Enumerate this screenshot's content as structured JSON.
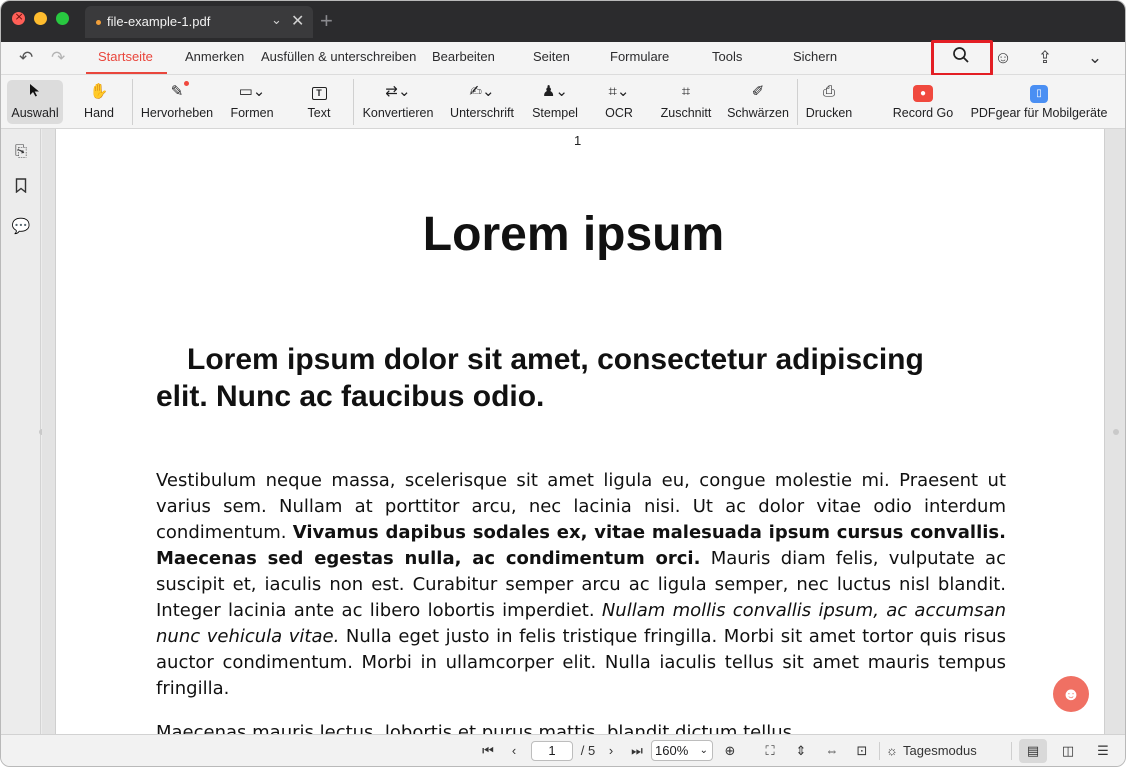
{
  "window": {
    "tab_title": "file-example-1.pdf"
  },
  "menu": {
    "tabs": [
      "Startseite",
      "Anmerken",
      "Ausfüllen & unterschreiben",
      "Bearbeiten",
      "Seiten",
      "Formulare",
      "Tools",
      "Sichern"
    ],
    "active_tab": "Startseite"
  },
  "toolbar": {
    "tools": [
      {
        "label": "Auswahl",
        "icon": "cursor-arrow-icon",
        "glyph": "➤"
      },
      {
        "label": "Hand",
        "icon": "hand-icon",
        "glyph": "✋"
      },
      {
        "label": "Hervorheben",
        "icon": "highlighter-icon",
        "glyph": "✎"
      },
      {
        "label": "Formen",
        "icon": "rectangle-shape-icon",
        "glyph": "▭⌄"
      },
      {
        "label": "Text",
        "icon": "text-box-icon",
        "glyph": "T"
      },
      {
        "label": "Konvertieren",
        "icon": "convert-icon",
        "glyph": "⇄⌄"
      },
      {
        "label": "Unterschrift",
        "icon": "signature-icon",
        "glyph": "✍⌄"
      },
      {
        "label": "Stempel",
        "icon": "stamp-icon",
        "glyph": "♟⌄"
      },
      {
        "label": "OCR",
        "icon": "ocr-icon",
        "glyph": "⌗⌄"
      },
      {
        "label": "Zuschnitt",
        "icon": "crop-icon",
        "glyph": "⌗"
      },
      {
        "label": "Schwärzen",
        "icon": "redact-icon",
        "glyph": "✐"
      },
      {
        "label": "Drucken",
        "icon": "printer-icon",
        "glyph": "⎙"
      },
      {
        "label": "Record Go",
        "icon": "record-icon",
        "glyph": "●"
      },
      {
        "label": "PDFgear für Mobilgeräte",
        "icon": "mobile-device-icon",
        "glyph": "▯"
      }
    ]
  },
  "document": {
    "page_label": "1",
    "title": "Lorem ipsum",
    "subtitle": "Lorem ipsum dolor sit amet, consectetur adipiscing elit. Nunc ac faucibus odio.",
    "para1_a": "Vestibulum neque massa, scelerisque sit amet ligula eu, congue molestie mi. Praesent ut varius sem. Nullam at porttitor arcu, nec lacinia nisi. Ut ac dolor vitae odio interdum condimentum. ",
    "para1_bold": "Vivamus dapibus sodales ex, vitae malesuada ipsum cursus convallis. Maecenas sed egestas nulla, ac condimentum orci.",
    "para1_b": " Mauris diam felis, vulputate ac suscipit et, iaculis non est. Curabitur semper arcu ac ligula semper, nec luctus nisl blandit. Integer lacinia ante ac libero lobortis imperdiet. ",
    "para1_italic": "Nullam mollis convallis ipsum, ac accumsan nunc vehicula vitae.",
    "para1_c": " Nulla eget justo in felis tristique fringilla. Morbi sit amet tortor quis risus auctor condimentum. Morbi in ullamcorper elit. Nulla iaculis tellus sit amet mauris tempus fringilla.",
    "para2": "Maecenas mauris lectus, lobortis et purus mattis, blandit dictum tellus."
  },
  "statusbar": {
    "current_page": "1",
    "total_pages": "/ 5",
    "zoom": "160%",
    "day_mode": "Tagesmodus"
  },
  "colors": {
    "accent": "#e9463c",
    "highlight_box": "#e31e24"
  }
}
